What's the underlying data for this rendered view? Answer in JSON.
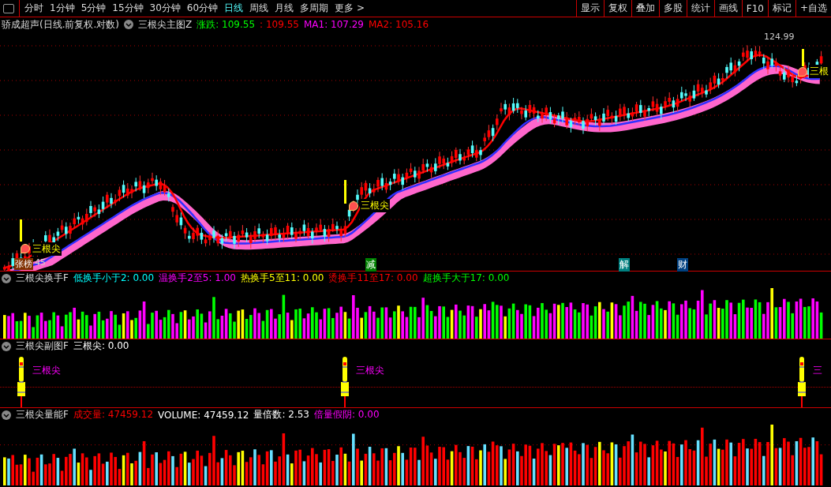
{
  "toolbar": {
    "periods": [
      {
        "label": "分时",
        "selected": false
      },
      {
        "label": "1分钟",
        "selected": false
      },
      {
        "label": "5分钟",
        "selected": false
      },
      {
        "label": "15分钟",
        "selected": false
      },
      {
        "label": "30分钟",
        "selected": false
      },
      {
        "label": "60分钟",
        "selected": false
      },
      {
        "label": "日线",
        "selected": true
      },
      {
        "label": "周线",
        "selected": false
      },
      {
        "label": "月线",
        "selected": false
      },
      {
        "label": "多周期",
        "selected": false
      },
      {
        "label": "更多 >",
        "selected": false
      }
    ],
    "buttons": [
      "显示",
      "复权",
      "叠加",
      "多股",
      "统计",
      "画线",
      "F10",
      "标记",
      "+自选"
    ]
  },
  "main_chart": {
    "stock": "骄成超声(日线.前复权.对数)",
    "indicator": "三根尖主图Z",
    "readouts": [
      {
        "text": "涨跌: 109.55",
        "color": "#00ff00"
      },
      {
        "text": ": 109.55",
        "color": "#ff0000"
      },
      {
        "text": "MA1: 107.29",
        "color": "#ff00ff"
      },
      {
        "text": "MA2: 105.16",
        "color": "#ff0000"
      }
    ],
    "high_label": "124.99",
    "low_label": "45",
    "rank_badge": "张榜",
    "signals": [
      "三根尖",
      "三根尖",
      "三根"
    ],
    "events": [
      {
        "text": "减",
        "color": "#008000"
      },
      {
        "text": "解",
        "color": "#008080"
      },
      {
        "text": "财",
        "color": "#004080"
      }
    ]
  },
  "panels": [
    {
      "kind": "turnover",
      "name": "三根尖换手F",
      "readouts": [
        {
          "text": "低换手小于2: 0.00",
          "color": "#00ffff"
        },
        {
          "text": "温换手2至5: 1.00",
          "color": "#ff00ff"
        },
        {
          "text": "热换手5至11: 0.00",
          "color": "#ffff00"
        },
        {
          "text": "烫换手11至17: 0.00",
          "color": "#ff0000"
        },
        {
          "text": "超换手大于17: 0.00",
          "color": "#00ff00"
        }
      ]
    },
    {
      "kind": "signal",
      "name": "三根尖副图F",
      "readouts": [
        {
          "text": "三根尖: 0.00",
          "color": "#ffffff"
        }
      ],
      "labels": [
        "三根尖",
        "三根尖",
        "三"
      ]
    },
    {
      "kind": "volume",
      "name": "三根尖量能F",
      "readouts": [
        {
          "text": "成交量: 47459.12",
          "color": "#ff0000"
        },
        {
          "text": "VOLUME: 47459.12",
          "color": "#ffffff"
        },
        {
          "text": "量倍数: 2.53",
          "color": "#ffffff"
        },
        {
          "text": "倍量假阴: 0.00",
          "color": "#ff00ff"
        }
      ]
    }
  ]
}
